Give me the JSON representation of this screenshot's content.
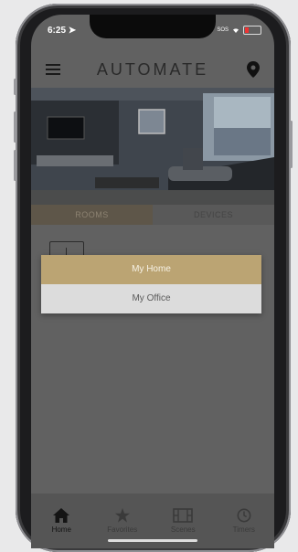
{
  "status": {
    "time": "6:25",
    "carrier": "SOS"
  },
  "header": {
    "logo": "AUTOMATE"
  },
  "tabs": [
    {
      "label": "ROOMS"
    },
    {
      "label": "DEVICES"
    }
  ],
  "dropdown": {
    "options": [
      {
        "label": "My Home"
      },
      {
        "label": "My Office"
      }
    ],
    "selected": "My Home"
  },
  "bottom_nav": [
    {
      "label": "Home",
      "icon": "home-icon"
    },
    {
      "label": "Favorites",
      "icon": "star-icon"
    },
    {
      "label": "Scenes",
      "icon": "film-icon"
    },
    {
      "label": "Timers",
      "icon": "clock-icon"
    }
  ],
  "colors": {
    "accent": "#bba473",
    "overlay": "#616161",
    "nav_bg": "#555555"
  }
}
